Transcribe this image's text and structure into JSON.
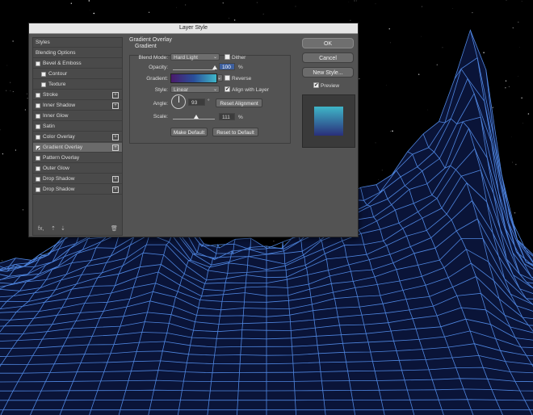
{
  "window": {
    "title": "Layer Style"
  },
  "sidebar": {
    "items": [
      {
        "label": "Styles",
        "checkbox": false,
        "checked": false,
        "plus": false,
        "selected": false
      },
      {
        "label": "Blending Options",
        "checkbox": false,
        "checked": false,
        "plus": false,
        "selected": false
      },
      {
        "label": "Bevel & Emboss",
        "checkbox": true,
        "checked": false,
        "plus": false,
        "selected": false
      },
      {
        "label": "Contour",
        "checkbox": true,
        "checked": false,
        "plus": false,
        "selected": false,
        "indent": true
      },
      {
        "label": "Texture",
        "checkbox": true,
        "checked": false,
        "plus": false,
        "selected": false,
        "indent": true
      },
      {
        "label": "Stroke",
        "checkbox": true,
        "checked": false,
        "plus": true,
        "selected": false
      },
      {
        "label": "Inner Shadow",
        "checkbox": true,
        "checked": false,
        "plus": true,
        "selected": false
      },
      {
        "label": "Inner Glow",
        "checkbox": true,
        "checked": false,
        "plus": false,
        "selected": false
      },
      {
        "label": "Satin",
        "checkbox": true,
        "checked": false,
        "plus": false,
        "selected": false
      },
      {
        "label": "Color Overlay",
        "checkbox": true,
        "checked": false,
        "plus": true,
        "selected": false
      },
      {
        "label": "Gradient Overlay",
        "checkbox": true,
        "checked": true,
        "plus": true,
        "selected": true
      },
      {
        "label": "Pattern Overlay",
        "checkbox": true,
        "checked": false,
        "plus": false,
        "selected": false
      },
      {
        "label": "Outer Glow",
        "checkbox": true,
        "checked": false,
        "plus": false,
        "selected": false
      },
      {
        "label": "Drop Shadow",
        "checkbox": true,
        "checked": false,
        "plus": true,
        "selected": false
      },
      {
        "label": "Drop Shadow",
        "checkbox": true,
        "checked": false,
        "plus": true,
        "selected": false
      }
    ],
    "footer_icons": [
      "fx-icon",
      "arrow-up-icon",
      "arrow-down-icon",
      "trash-icon"
    ],
    "fx_label": "fx,"
  },
  "panel": {
    "title": "Gradient Overlay",
    "subtitle": "Gradient",
    "blend_mode_label": "Blend Mode:",
    "blend_mode_value": "Hard Light",
    "dither_label": "Dither",
    "opacity_label": "Opacity:",
    "opacity_value": "100",
    "opacity_unit": "%",
    "opacity_fraction": 1.0,
    "gradient_label": "Gradient:",
    "gradient_colors": [
      "#4a1a6a",
      "#2a4f9a",
      "#3fb6c8"
    ],
    "reverse_label": "Reverse",
    "style_label": "Style:",
    "style_value": "Linear",
    "align_label": "Align with Layer",
    "align_checked": true,
    "angle_label": "Angle:",
    "angle_value": "93",
    "angle_unit": "°",
    "reset_alignment_label": "Reset Alignment",
    "scale_label": "Scale:",
    "scale_value": "111",
    "scale_unit": "%",
    "scale_fraction": 0.555,
    "make_default_label": "Make Default",
    "reset_default_label": "Reset to Default"
  },
  "actions": {
    "ok_label": "OK",
    "cancel_label": "Cancel",
    "new_style_label": "New Style...",
    "preview_label": "Preview",
    "preview_checked": true
  },
  "colors": {
    "dialog_bg": "#535353",
    "grid_line": "#4f86e0",
    "preview_top": "#3fb6c8",
    "preview_bottom": "#2a2f7a"
  }
}
